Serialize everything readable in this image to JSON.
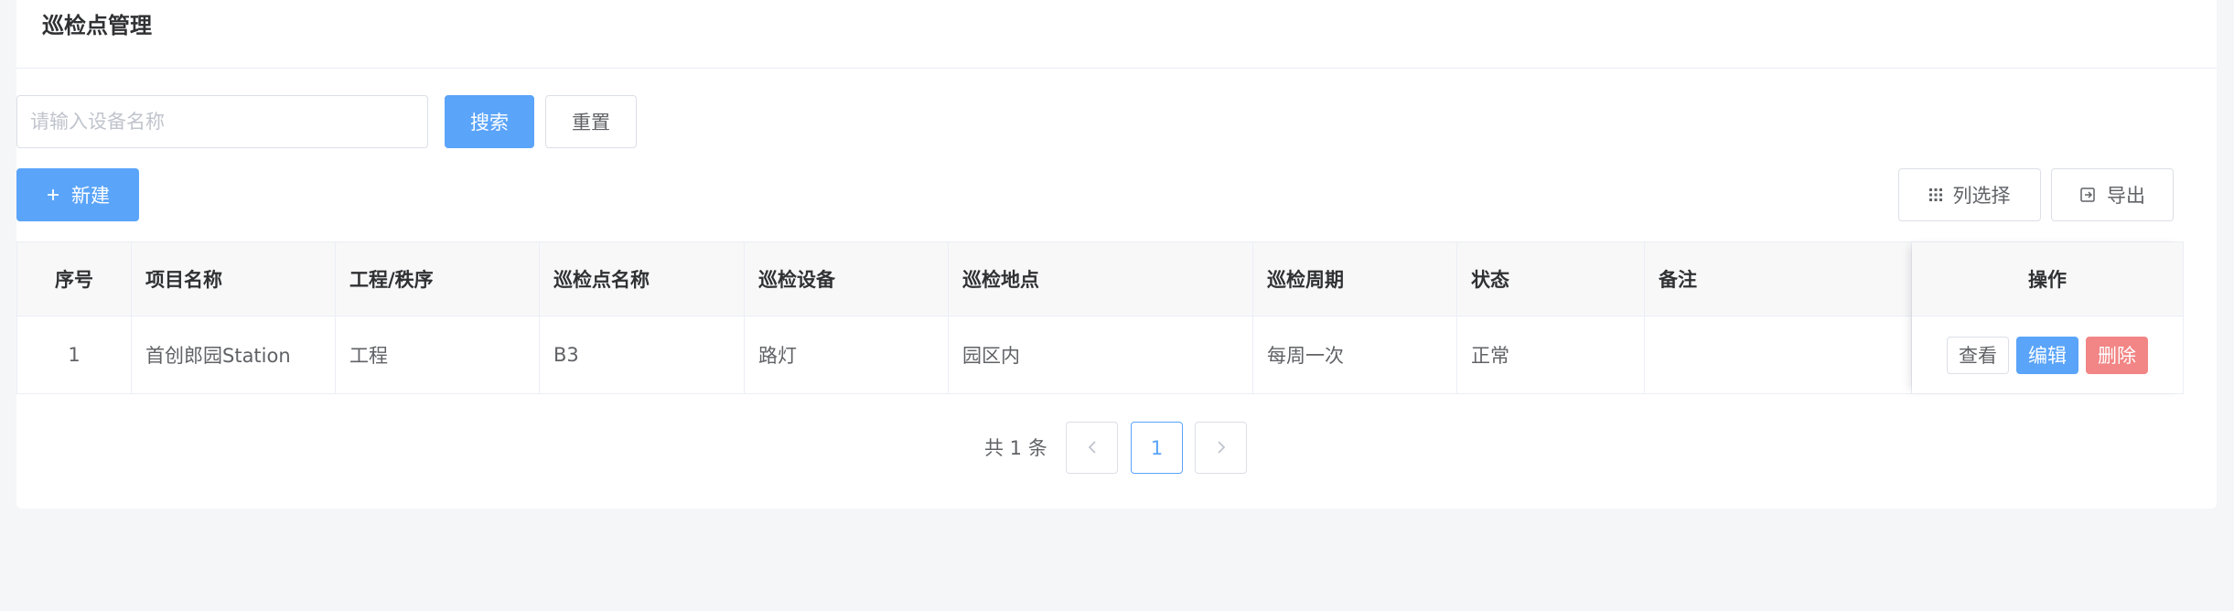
{
  "header": {
    "title": "巡检点管理"
  },
  "search": {
    "placeholder": "请输入设备名称",
    "value": "",
    "search_label": "搜索",
    "reset_label": "重置"
  },
  "toolbar": {
    "new_label": "新建",
    "columns_label": "列选择",
    "export_label": "导出"
  },
  "table": {
    "columns": [
      "序号",
      "项目名称",
      "工程/秩序",
      "巡检点名称",
      "巡检设备",
      "巡检地点",
      "巡检周期",
      "状态",
      "备注",
      "操作"
    ],
    "rows": [
      {
        "index": "1",
        "project": "首创郎园Station",
        "type": "工程",
        "point": "B3",
        "device": "路灯",
        "location": "园区内",
        "cycle": "每周一次",
        "status": "正常",
        "remark": "",
        "actions": {
          "view": "查看",
          "edit": "编辑",
          "delete": "删除"
        }
      }
    ]
  },
  "pagination": {
    "total_text": "共 1 条",
    "current_page": "1"
  },
  "colors": {
    "primary": "#5aa4f9",
    "danger": "#f28585",
    "page_bg": "#f5f6f8"
  },
  "icons": [
    "plus-icon",
    "grid-icon",
    "export-icon",
    "chevron-left-icon",
    "chevron-right-icon"
  ]
}
